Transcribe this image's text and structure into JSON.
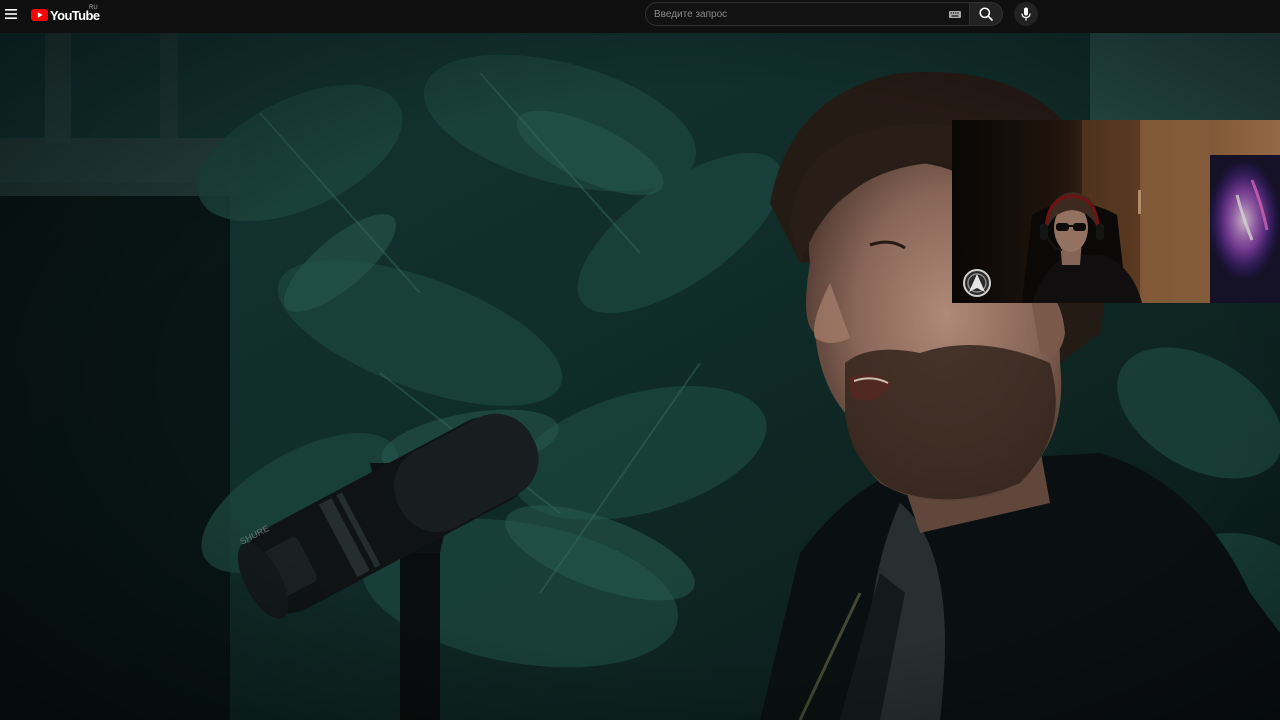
{
  "app": {
    "logo_text": "YouTube",
    "country_code": "RU"
  },
  "search": {
    "placeholder": "Введите запрос"
  },
  "icons": {
    "menu": "hamburger-menu-icon",
    "logo": "youtube-play-logo-icon",
    "keyboard": "keyboard-icon",
    "search": "search-icon",
    "mic": "microphone-icon",
    "badge": "arrow-up-badge-icon"
  },
  "colors": {
    "masthead_bg": "#0f0f0f",
    "logo_red": "#ff0000",
    "video_tone": "#0d1c1a"
  }
}
